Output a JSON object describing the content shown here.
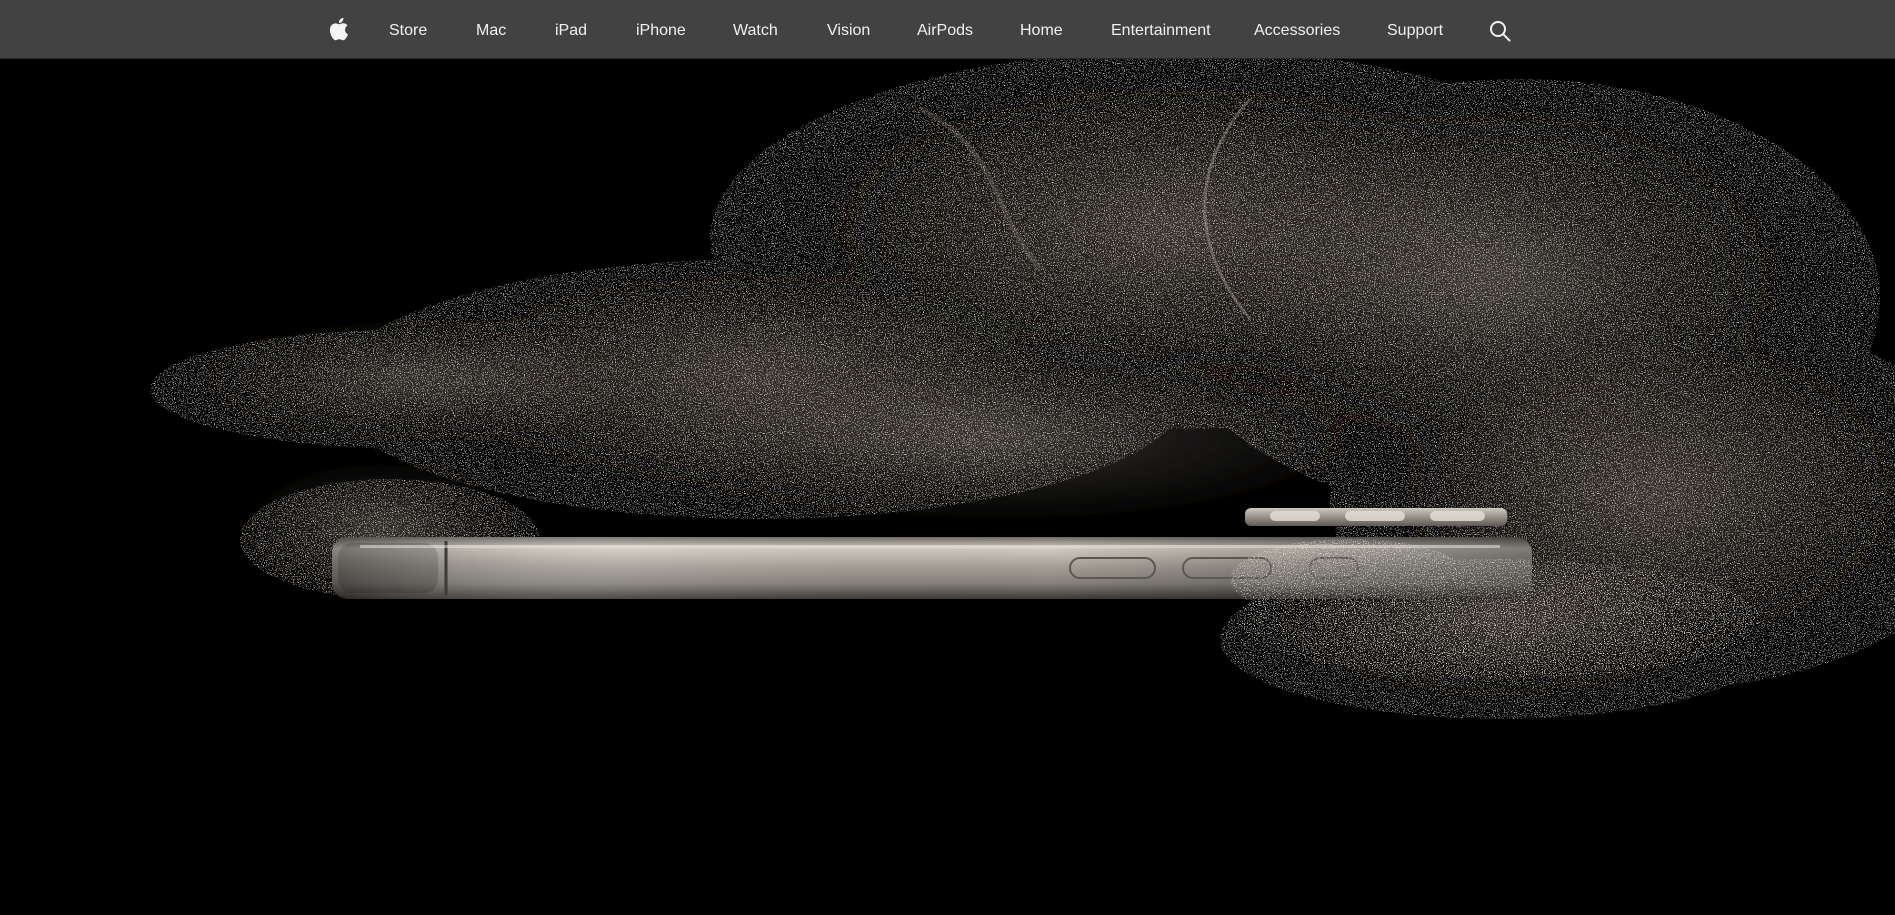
{
  "nav": {
    "logo_icon": "apple-logo-icon",
    "items": [
      {
        "label": "Store"
      },
      {
        "label": "Mac"
      },
      {
        "label": "iPad"
      },
      {
        "label": "iPhone"
      },
      {
        "label": "Watch"
      },
      {
        "label": "Vision"
      },
      {
        "label": "AirPods"
      },
      {
        "label": "Home"
      },
      {
        "label": "Entertainment"
      },
      {
        "label": "Accessories"
      },
      {
        "label": "Support"
      }
    ],
    "search_icon": "search-icon"
  },
  "hero": {
    "image": "iphone-titanium-side-profile-with-particle-dust"
  },
  "colors": {
    "nav_background": "#424242",
    "nav_text": "#f0f0f0",
    "hero_background": "#000000",
    "titanium": "#a8a39a"
  }
}
